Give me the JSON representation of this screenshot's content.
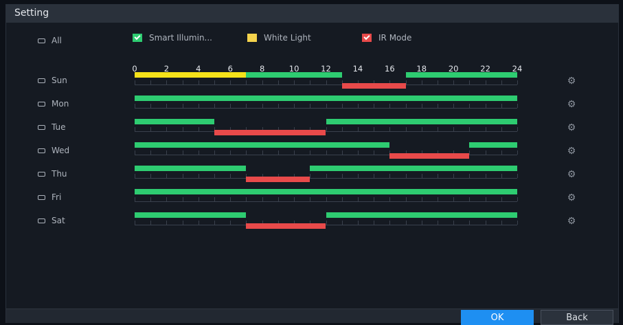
{
  "window": {
    "title": "Setting"
  },
  "all_label": "All",
  "legend": [
    {
      "label": "Smart Illumin...",
      "color": "#2ecc71",
      "checked": true
    },
    {
      "label": "White Light",
      "color": "#f5d34c",
      "checked": false
    },
    {
      "label": "IR Mode",
      "color": "#e84a4a",
      "checked": true
    }
  ],
  "hours": [
    "0",
    "2",
    "4",
    "6",
    "8",
    "10",
    "12",
    "14",
    "16",
    "18",
    "20",
    "22",
    "24"
  ],
  "colors": {
    "smart": "#2ecc71",
    "white": "#f5e21a",
    "ir": "#e84a4a"
  },
  "days": [
    {
      "label": "Sun",
      "segments": [
        {
          "mode": "white",
          "start": 0,
          "end": 7
        },
        {
          "mode": "smart",
          "start": 7,
          "end": 13
        },
        {
          "mode": "ir",
          "start": 13,
          "end": 17
        },
        {
          "mode": "smart",
          "start": 17,
          "end": 24
        }
      ]
    },
    {
      "label": "Mon",
      "segments": [
        {
          "mode": "smart",
          "start": 0,
          "end": 24
        }
      ]
    },
    {
      "label": "Tue",
      "segments": [
        {
          "mode": "smart",
          "start": 0,
          "end": 5
        },
        {
          "mode": "ir",
          "start": 5,
          "end": 12
        },
        {
          "mode": "smart",
          "start": 12,
          "end": 24
        }
      ]
    },
    {
      "label": "Wed",
      "segments": [
        {
          "mode": "smart",
          "start": 0,
          "end": 16
        },
        {
          "mode": "ir",
          "start": 16,
          "end": 21
        },
        {
          "mode": "smart",
          "start": 21,
          "end": 24
        }
      ]
    },
    {
      "label": "Thu",
      "segments": [
        {
          "mode": "smart",
          "start": 0,
          "end": 7
        },
        {
          "mode": "ir",
          "start": 7,
          "end": 11
        },
        {
          "mode": "smart",
          "start": 11,
          "end": 24
        }
      ]
    },
    {
      "label": "Fri",
      "segments": [
        {
          "mode": "smart",
          "start": 0,
          "end": 24
        }
      ]
    },
    {
      "label": "Sat",
      "segments": [
        {
          "mode": "smart",
          "start": 0,
          "end": 7
        },
        {
          "mode": "ir",
          "start": 7,
          "end": 12
        },
        {
          "mode": "smart",
          "start": 12,
          "end": 24
        }
      ]
    }
  ],
  "buttons": {
    "ok": "OK",
    "back": "Back"
  }
}
